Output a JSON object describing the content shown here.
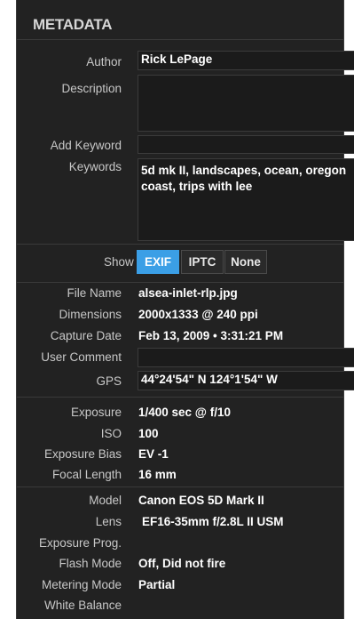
{
  "panel": {
    "title": "METADATA"
  },
  "fields": {
    "author": {
      "label": "Author",
      "value": "Rick LePage"
    },
    "description": {
      "label": "Description",
      "value": ""
    },
    "add_keyword": {
      "label": "Add Keyword",
      "value": ""
    },
    "keywords": {
      "label": "Keywords",
      "value": "5d mk II, landscapes, ocean, oregon coast, trips with lee"
    }
  },
  "show": {
    "label": "Show",
    "options": [
      "EXIF",
      "IPTC",
      "None"
    ],
    "selected": "EXIF"
  },
  "file_info": {
    "file_name": {
      "label": "File Name",
      "value": "alsea-inlet-rlp.jpg"
    },
    "dimensions": {
      "label": "Dimensions",
      "value": "2000x1333 @ 240 ppi"
    },
    "capture_date": {
      "label": "Capture Date",
      "value": "Feb 13, 2009 • 3:31:21 PM"
    },
    "user_comment": {
      "label": "User Comment",
      "value": ""
    },
    "gps": {
      "label": "GPS",
      "value": "44°24'54\" N 124°1'54\" W"
    }
  },
  "exposure_info": {
    "exposure": {
      "label": "Exposure",
      "value": "1/400 sec @ f/10"
    },
    "iso": {
      "label": "ISO",
      "value": "100"
    },
    "exposure_bias": {
      "label": "Exposure Bias",
      "value": "EV -1"
    },
    "focal_length": {
      "label": "Focal Length",
      "value": "16 mm"
    }
  },
  "camera_info": {
    "model": {
      "label": "Model",
      "value": "Canon EOS 5D Mark II"
    },
    "lens": {
      "label": "Lens",
      "value": "EF16-35mm f/2.8L II USM"
    },
    "exposure_prog": {
      "label": "Exposure Prog.",
      "value": ""
    },
    "flash_mode": {
      "label": "Flash Mode",
      "value": "Off, Did not fire"
    },
    "metering_mode": {
      "label": "Metering Mode",
      "value": "Partial"
    },
    "white_balance": {
      "label": "White Balance",
      "value": ""
    }
  },
  "colors": {
    "panel_bg": "#222222",
    "accent": "#3b9fe6",
    "text": "#ffffff"
  }
}
